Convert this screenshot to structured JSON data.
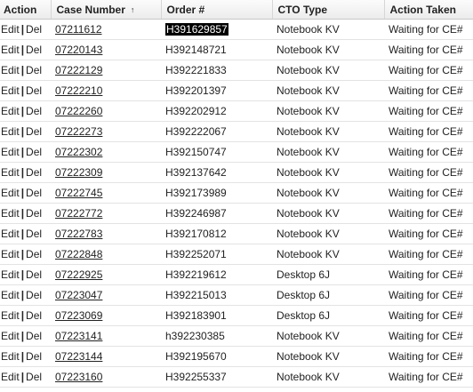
{
  "table": {
    "columns": [
      {
        "label": "Action"
      },
      {
        "label": "Case Number",
        "sort": "↑"
      },
      {
        "label": "Order #"
      },
      {
        "label": "CTO Type"
      },
      {
        "label": "Action Taken"
      }
    ],
    "edit_label": "Edit",
    "separator": "|",
    "del_label": "Del",
    "rows": [
      {
        "case": "07211612",
        "order": "H391629857",
        "cto": "Notebook KV",
        "taken": "Waiting for CE#"
      },
      {
        "case": "07220143",
        "order": "H392148721",
        "cto": "Notebook KV",
        "taken": "Waiting for CE#"
      },
      {
        "case": "07222129",
        "order": "H392221833",
        "cto": "Notebook KV",
        "taken": "Waiting for CE#"
      },
      {
        "case": "07222210",
        "order": "H392201397",
        "cto": "Notebook KV",
        "taken": "Waiting for CE#"
      },
      {
        "case": "07222260",
        "order": "H392202912",
        "cto": "Notebook KV",
        "taken": "Waiting for CE#"
      },
      {
        "case": "07222273",
        "order": "H392222067",
        "cto": "Notebook KV",
        "taken": "Waiting for CE#"
      },
      {
        "case": "07222302",
        "order": "H392150747",
        "cto": "Notebook KV",
        "taken": "Waiting for CE#"
      },
      {
        "case": "07222309",
        "order": "H392137642",
        "cto": "Notebook KV",
        "taken": "Waiting for CE#"
      },
      {
        "case": "07222745",
        "order": "H392173989",
        "cto": "Notebook KV",
        "taken": "Waiting for CE#"
      },
      {
        "case": "07222772",
        "order": "H392246987",
        "cto": "Notebook KV",
        "taken": "Waiting for CE#"
      },
      {
        "case": "07222783",
        "order": "H392170812",
        "cto": "Notebook KV",
        "taken": "Waiting for CE#"
      },
      {
        "case": "07222848",
        "order": "H392252071",
        "cto": "Notebook KV",
        "taken": "Waiting for CE#"
      },
      {
        "case": "07222925",
        "order": "H392219612",
        "cto": "Desktop 6J",
        "taken": "Waiting for CE#"
      },
      {
        "case": "07223047",
        "order": "H392215013",
        "cto": "Desktop 6J",
        "taken": "Waiting for CE#"
      },
      {
        "case": "07223069",
        "order": "H392183901",
        "cto": "Desktop 6J",
        "taken": "Waiting for CE#"
      },
      {
        "case": "07223141",
        "order": "h392230385",
        "cto": "Notebook KV",
        "taken": "Waiting for CE#"
      },
      {
        "case": "07223144",
        "order": "H392195670",
        "cto": "Notebook KV",
        "taken": "Waiting for CE#"
      },
      {
        "case": "07223160",
        "order": "H392255337",
        "cto": "Notebook KV",
        "taken": "Waiting for CE#"
      }
    ],
    "selected_row": 0
  }
}
